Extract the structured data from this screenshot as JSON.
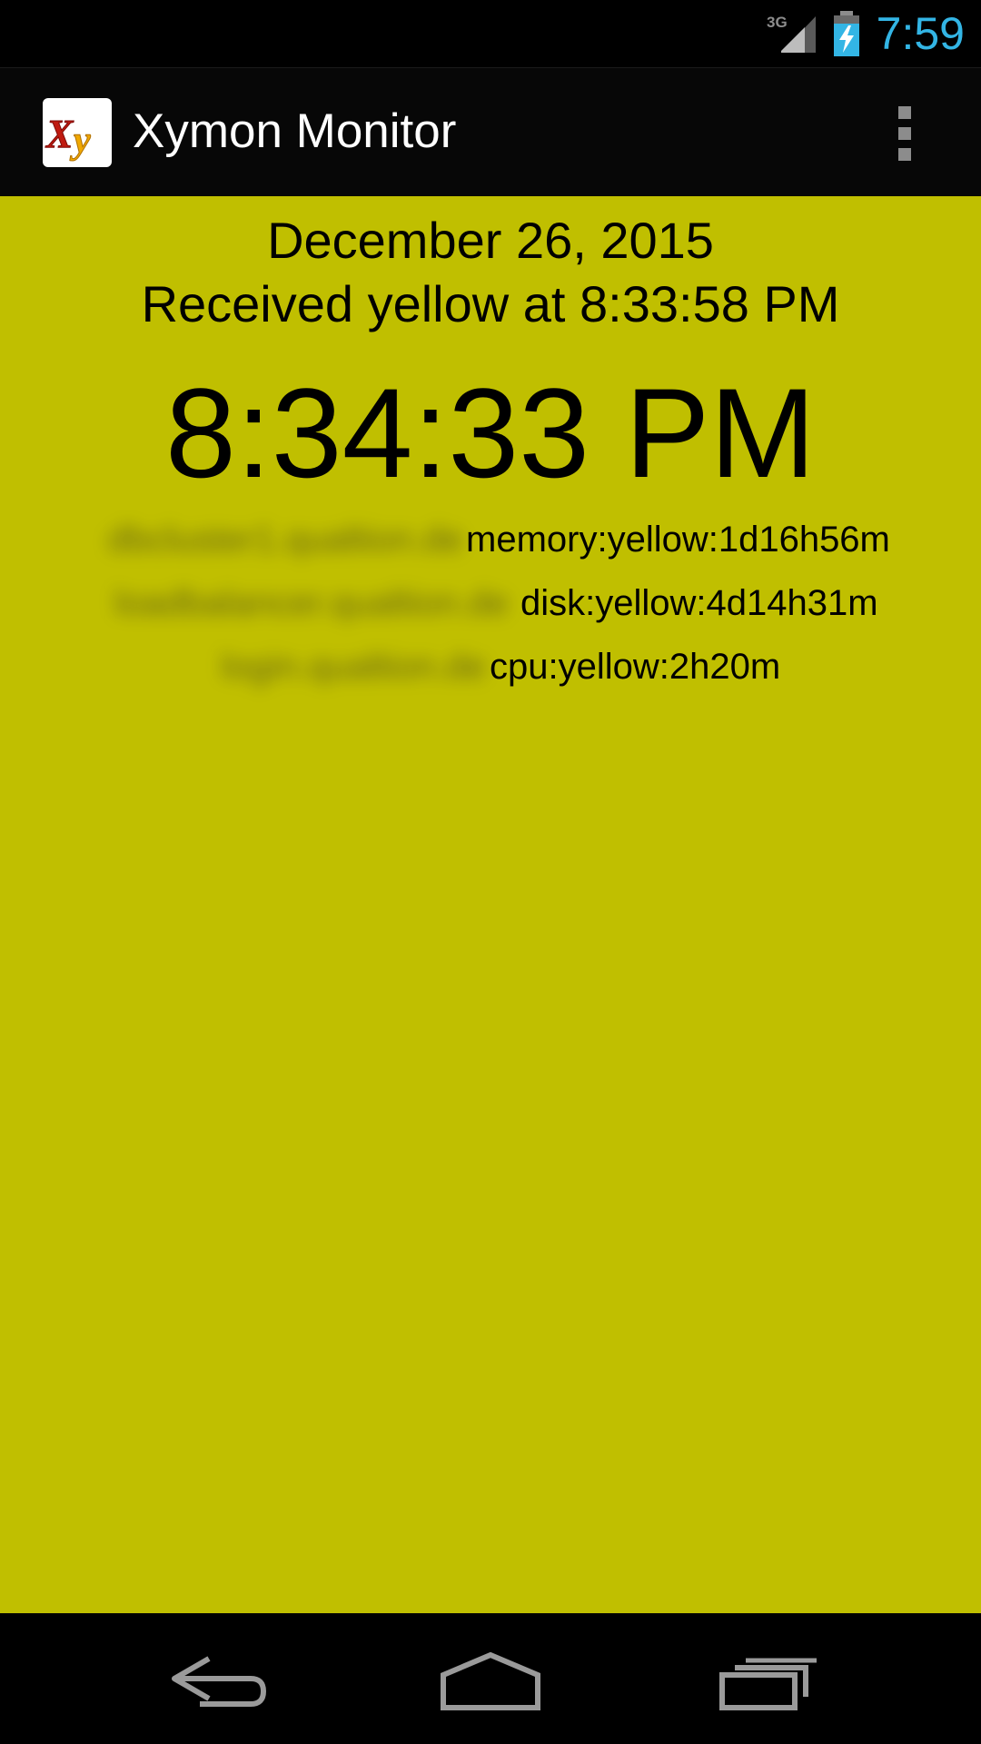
{
  "status_bar": {
    "network_type": "3G",
    "time": "7:59",
    "icons": [
      "signal-3g-icon",
      "battery-charging-icon"
    ],
    "time_color": "#33b5e5"
  },
  "action_bar": {
    "app_icon_text": "Xy",
    "title": "Xymon Monitor",
    "overflow_icon": "overflow-menu-icon",
    "divider_color": "#33b5e5"
  },
  "content": {
    "background_color": "#c0bf00",
    "status_color": "yellow",
    "date": "December 26, 2015",
    "received": "Received yellow at 8:33:58 PM",
    "current_time": "8:34:33 PM",
    "alerts": [
      {
        "host": "dbcluster1.qualtion.de",
        "status": "memory:yellow:1d16h56m"
      },
      {
        "host": "loadbalancer.qualtion.de",
        "status": "disk:yellow:4d14h31m"
      },
      {
        "host": "login.qualtion.de",
        "status": "cpu:yellow:2h20m"
      }
    ]
  },
  "nav_bar": {
    "icons": [
      "back-icon",
      "home-icon",
      "recents-icon"
    ]
  }
}
